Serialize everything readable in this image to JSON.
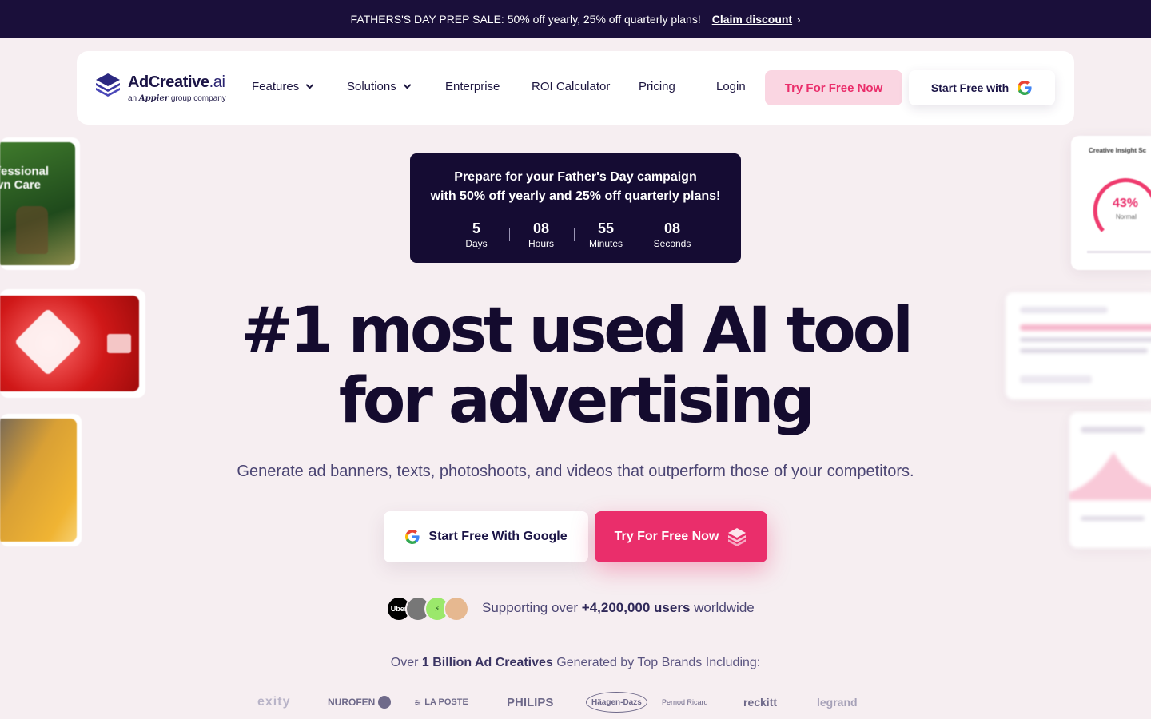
{
  "promo": {
    "text": "FATHERS'S DAY PREP SALE: 50% off yearly, 25% off quarterly plans!",
    "link": "Claim discount",
    "link_icon": "chevron-right-icon"
  },
  "nav": {
    "logo_name": "AdCreative",
    "logo_suffix": ".ai",
    "logo_sub_prefix": "an",
    "logo_sub_brand": "Appier",
    "logo_sub_suffix": "group company",
    "items": [
      {
        "label": "Features",
        "dropdown": true
      },
      {
        "label": "Solutions",
        "dropdown": true
      },
      {
        "label": "Enterprise"
      },
      {
        "label": "ROI Calculator"
      },
      {
        "label": "Pricing"
      }
    ],
    "login": "Login",
    "try_button": "Try For Free Now",
    "google_button": "Start Free with"
  },
  "countdown": {
    "line1": "Prepare for your Father's Day campaign",
    "line2": "with 50% off yearly and 25% off quarterly plans!",
    "units": [
      {
        "value": "5",
        "label": "Days"
      },
      {
        "value": "08",
        "label": "Hours"
      },
      {
        "value": "55",
        "label": "Minutes"
      },
      {
        "value": "08",
        "label": "Seconds"
      }
    ]
  },
  "hero": {
    "line1": "#1 most used AI tool",
    "line2": "for advertising",
    "subtitle": "Generate ad banners, texts, photoshoots, and videos that outperform those of your competitors.",
    "google_button": "Start Free With Google",
    "try_button": "Try For Free Now"
  },
  "social": {
    "prefix": "Supporting over",
    "count": "+4,200,000 users",
    "suffix": "worldwide",
    "avatar_uber": "Uber"
  },
  "brands": {
    "prefix": "Over",
    "bold": "1 Billion Ad Creatives",
    "suffix": "Generated by Top Brands Including:",
    "logos": [
      "exity",
      "NUROFEN",
      "LA POSTE",
      "PHILIPS",
      "Häagen-Dazs",
      "Pernod Ricard",
      "reckitt",
      "legrand"
    ]
  },
  "side_cards": {
    "left_top_line1": "fessional",
    "left_top_line2": "vn Care",
    "right_top_title": "Creative Insight Sc",
    "right_top_value": "43%",
    "right_top_status": "Normal"
  },
  "colors": {
    "accent": "#ea2e6b",
    "dark": "#150c33",
    "background": "#f6eef1"
  }
}
